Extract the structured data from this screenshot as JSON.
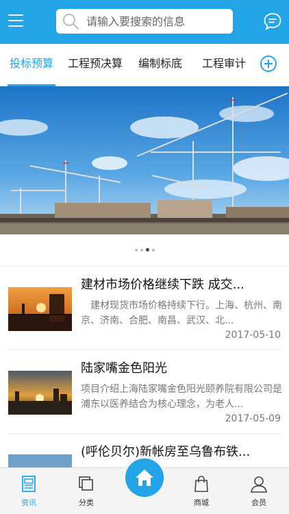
{
  "header": {
    "search_placeholder": "请输入要搜索的信息",
    "accent_color": "#22a4e6",
    "menu_icon": "menu-icon",
    "chat_icon": "chat-icon"
  },
  "tabs": [
    {
      "label": "投标预算",
      "active": true
    },
    {
      "label": "工程预决算",
      "active": false
    },
    {
      "label": "编制标底",
      "active": false
    },
    {
      "label": "工程审计",
      "active": false
    }
  ],
  "banner": {
    "dots_total": 4,
    "dots_active": 3
  },
  "news": [
    {
      "title": "建材市场价格继续下跌 成交...",
      "desc": "　建材现货市场价格持续下行。上海、杭州、南京、济南、合肥、南昌、武汉、北...",
      "date": "2017-05-10"
    },
    {
      "title": "陆家嘴金色阳光",
      "desc": "项目介绍上海陆家嘴金色阳光颐养院有限公司是浦东以医养结合为核心理念，为老人...",
      "date": "2017-05-09"
    },
    {
      "title": "(呼伦贝尔)新帐房至乌鲁布铁...",
      "desc": "",
      "date": ""
    }
  ],
  "bottom_nav": [
    {
      "label": "资讯",
      "icon": "news-icon",
      "active": true
    },
    {
      "label": "分类",
      "icon": "category-icon",
      "active": false
    },
    {
      "label": "",
      "icon": "home-icon",
      "active": false
    },
    {
      "label": "商城",
      "icon": "shop-bag-icon",
      "active": false
    },
    {
      "label": "会员",
      "icon": "user-icon",
      "active": false
    }
  ]
}
